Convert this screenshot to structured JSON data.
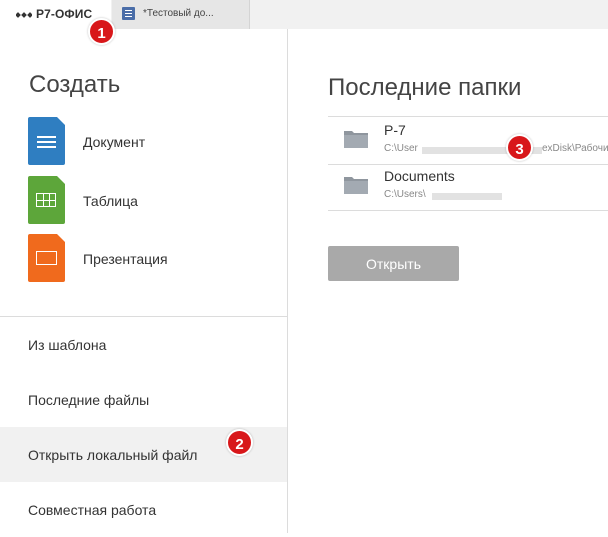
{
  "tabs": {
    "brand": "Р7-ОФИС",
    "document": "*Тестовый до..."
  },
  "sidebar": {
    "create_title": "Создать",
    "create_items": [
      {
        "label": "Документ",
        "icon": "document-icon",
        "color": "#2f7ec1"
      },
      {
        "label": "Таблица",
        "icon": "spreadsheet-icon",
        "color": "#5da63a"
      },
      {
        "label": "Презентация",
        "icon": "presentation-icon",
        "color": "#f06a1d"
      }
    ],
    "nav_items": [
      {
        "label": "Из шаблона"
      },
      {
        "label": "Последние файлы"
      },
      {
        "label": "Открыть локальный файл",
        "active": true
      },
      {
        "label": "Совместная работа"
      }
    ]
  },
  "main": {
    "title": "Последние папки",
    "folders": [
      {
        "name": "Р-7",
        "path_start": "C:\\User",
        "path_end": "exDisk\\Рабочи"
      },
      {
        "name": "Documents",
        "path_start": "C:\\Users\\"
      }
    ],
    "open_button": "Открыть"
  },
  "annotations": [
    "1",
    "2",
    "3"
  ],
  "colors": {
    "badge": "#d8171a",
    "button": "#a9a9a9",
    "active_nav": "#f1f1f1"
  }
}
